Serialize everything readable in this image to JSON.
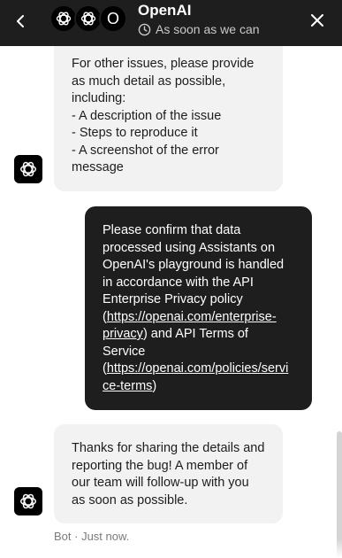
{
  "header": {
    "title": "OpenAI",
    "subtitle": "As soon as we can",
    "avatar_letter": "O",
    "icons": {
      "back": "chevron-left-icon",
      "close": "close-icon",
      "clock": "clock-icon",
      "logo": "openai-logo-icon"
    }
  },
  "messages": [
    {
      "sender": "bot",
      "lines": [
        "For other issues, please provide",
        "as much detail as possible,",
        "including:",
        "- A description of the issue",
        "- Steps to reproduce it",
        "- A screenshot of the error",
        "message"
      ]
    },
    {
      "sender": "user",
      "lines": [
        "Please confirm that data",
        "processed using Assistants on",
        "OpenAI's playground is handled",
        "in accordance with the API",
        "Enterprise Privacy policy"
      ],
      "link1_pre": "(",
      "link1_a": "https://openai.com/enterprise-",
      "link1_b": "privacy",
      "link1_post": ") and API Terms of",
      "line_service": "Service",
      "link2_pre": "(",
      "link2_a": "https://openai.com/policies/servi",
      "link2_b": "ce-terms",
      "link2_post": ")"
    },
    {
      "sender": "bot",
      "lines": [
        "Thanks for sharing the details and",
        "reporting the bug! A member of",
        "our team will follow-up with you",
        "as soon as possible."
      ]
    }
  ],
  "footer_meta": "Bot · Just now."
}
